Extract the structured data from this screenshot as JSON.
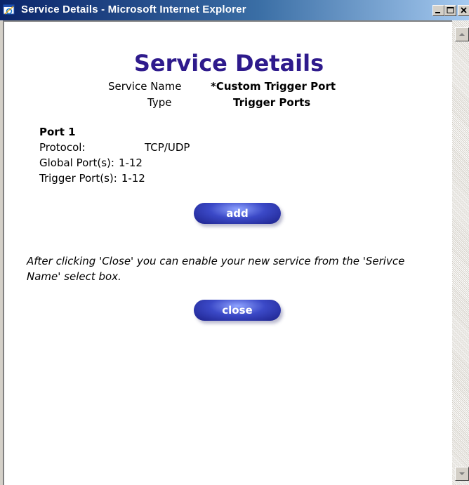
{
  "window": {
    "title": "Service Details - Microsoft Internet Explorer"
  },
  "page": {
    "heading": "Service Details",
    "service_name_label": "Service Name",
    "service_name_value": "*Custom Trigger Port",
    "type_label": "Type",
    "type_value": "Trigger Ports"
  },
  "port": {
    "title": "Port 1",
    "protocol_label": "Protocol:",
    "protocol_value": "TCP/UDP",
    "global_label": "Global Port(s):",
    "global_value": "1-12",
    "trigger_label": "Trigger Port(s):",
    "trigger_value": "1-12"
  },
  "buttons": {
    "add_label": "add",
    "close_label": "close"
  },
  "note": "After clicking 'Close' you can enable your new service from the 'Serivce Name' select box."
}
